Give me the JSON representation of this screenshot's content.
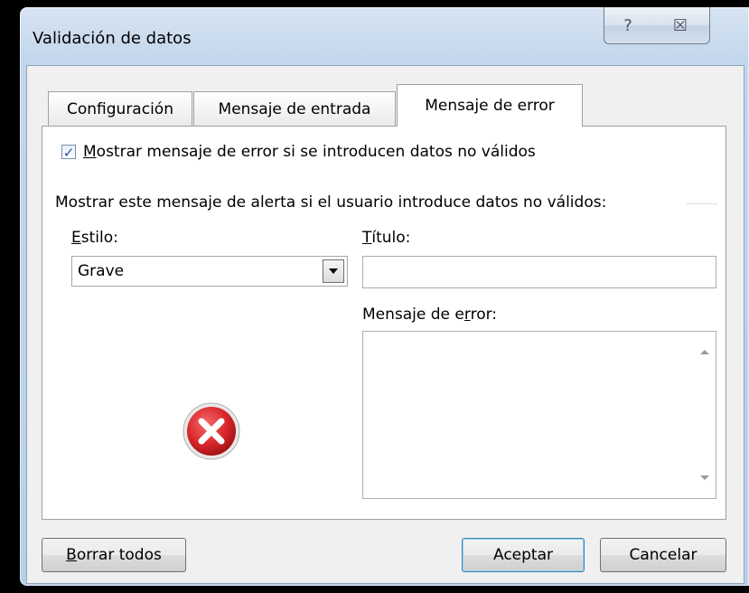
{
  "window": {
    "title": "Validación de datos",
    "help_glyph": "?",
    "close_glyph": "☒"
  },
  "tabs": [
    {
      "label": "Configuración",
      "selected": false
    },
    {
      "label": "Mensaje de entrada",
      "selected": false
    },
    {
      "label": "Mensaje de error",
      "selected": true
    }
  ],
  "error_tab": {
    "checkbox": {
      "checked": true,
      "label_mnemonic": "M",
      "label_rest": "ostrar mensaje de error si se introducen datos no válidos"
    },
    "group_label": "Mostrar este mensaje de alerta si el usuario introduce datos no válidos:",
    "style": {
      "label_mnemonic": "E",
      "label_rest": "stilo:",
      "selected": "Grave",
      "icon": "error-icon"
    },
    "title_field": {
      "label_mnemonic": "T",
      "label_rest": "ítulo:",
      "value": ""
    },
    "message_field": {
      "label_before": "Mensaje de e",
      "label_mnemonic": "r",
      "label_after": "ror:",
      "value": ""
    }
  },
  "buttons": {
    "clear_mnemonic": "B",
    "clear_rest": "orrar todos",
    "ok": "Aceptar",
    "cancel": "Cancelar"
  },
  "colors": {
    "accent": "#2d4fa0",
    "error_red": "#d9262a"
  }
}
